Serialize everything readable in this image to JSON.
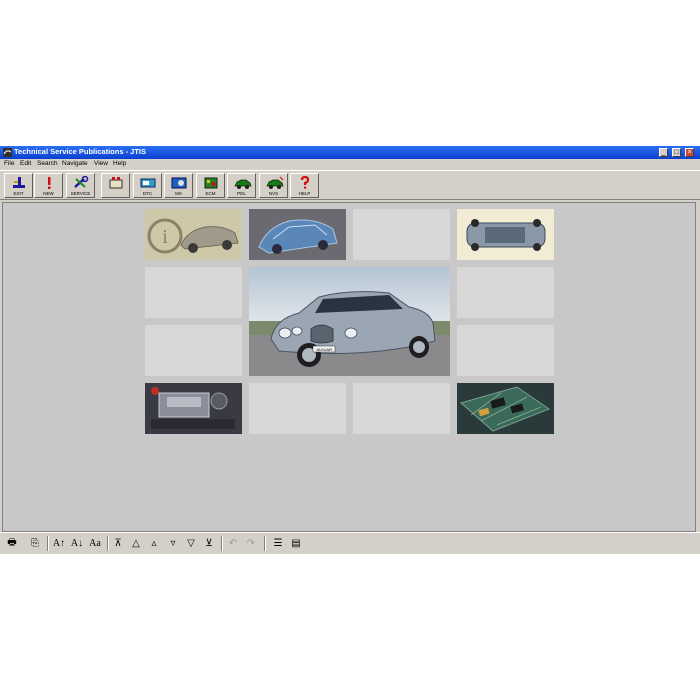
{
  "window": {
    "title": "Technical Service Publications - JTIS",
    "controls": {
      "minimize": "_",
      "maximize": "□",
      "close": "×"
    }
  },
  "menu": [
    "File",
    "Edit",
    "Search",
    "Navigate",
    "View",
    "Help"
  ],
  "toolbar": [
    {
      "label": "EXIT",
      "icon": "exit-icon"
    },
    {
      "label": "NEW",
      "icon": "exclamation-icon"
    },
    {
      "label": "SERVICE",
      "icon": "wrench-icon"
    },
    {
      "label": "",
      "icon": "engine-icon"
    },
    {
      "label": "DTC",
      "icon": "dtc-icon"
    },
    {
      "label": "MS",
      "icon": "module-icon"
    },
    {
      "label": "ECM",
      "icon": "ecm-icon"
    },
    {
      "label": "PDL",
      "icon": "car-pdl-icon"
    },
    {
      "label": "NVS",
      "icon": "car-nvs-icon"
    },
    {
      "label": "HELP",
      "icon": "question-icon"
    }
  ],
  "tiles": [
    {
      "name": "info-car-image",
      "image": "info-car"
    },
    {
      "name": "car-body-image",
      "image": "car-body"
    },
    {
      "name": "empty-tile",
      "image": ""
    },
    {
      "name": "chassis-image",
      "image": "chassis"
    },
    {
      "name": "empty-tile",
      "image": ""
    },
    {
      "name": "jaguar-car-image",
      "image": "jaguar-s-type",
      "plate": "JAGUAR"
    },
    {
      "name": "empty-tile",
      "image": ""
    },
    {
      "name": "empty-tile",
      "image": ""
    },
    {
      "name": "empty-tile",
      "image": ""
    },
    {
      "name": "engine-bay-image",
      "image": "engine"
    },
    {
      "name": "empty-tile",
      "image": ""
    },
    {
      "name": "empty-tile",
      "image": ""
    },
    {
      "name": "circuit-board-image",
      "image": "circuit-board"
    }
  ],
  "bottom_toolbar": [
    {
      "name": "print-button",
      "glyph": "🖶",
      "enabled": true
    },
    {
      "name": "copy-button",
      "glyph": "⎘",
      "enabled": true
    },
    {
      "name": "font-larger-button",
      "glyph": "A↑",
      "enabled": true
    },
    {
      "name": "font-smaller-button",
      "glyph": "A↓",
      "enabled": true
    },
    {
      "name": "font-case-button",
      "glyph": "Aa",
      "enabled": true
    },
    {
      "name": "first-page-button",
      "glyph": "⊼",
      "enabled": true
    },
    {
      "name": "previous-section-button",
      "glyph": "△",
      "enabled": true
    },
    {
      "name": "previous-page-button",
      "glyph": "▵",
      "enabled": true
    },
    {
      "name": "next-page-button",
      "glyph": "▿",
      "enabled": true
    },
    {
      "name": "next-section-button",
      "glyph": "▽",
      "enabled": true
    },
    {
      "name": "last-page-button",
      "glyph": "⊻",
      "enabled": true
    },
    {
      "name": "back-button",
      "glyph": "↶",
      "enabled": false
    },
    {
      "name": "forward-button",
      "glyph": "↷",
      "enabled": false
    },
    {
      "name": "list-button",
      "glyph": "☰",
      "enabled": true
    },
    {
      "name": "document-button",
      "glyph": "▤",
      "enabled": true
    }
  ],
  "colors": {
    "titlebar": "#0a3fd0",
    "face": "#d4d0c8",
    "content": "#c8c8c8",
    "tile": "#d7d7d7"
  }
}
